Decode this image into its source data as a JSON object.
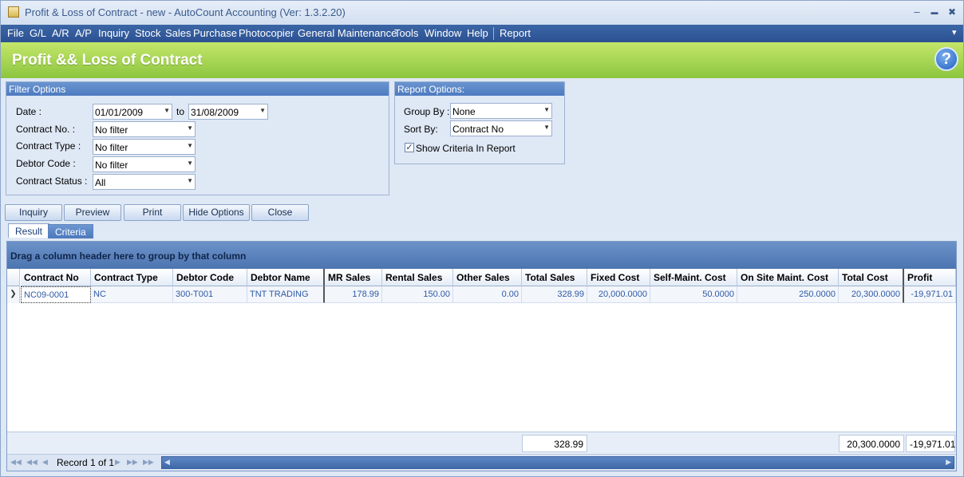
{
  "window": {
    "title": "Profit & Loss of Contract - new - AutoCount Accounting (Ver: 1.3.2.20)",
    "controls": [
      "–",
      "▬",
      "✖"
    ]
  },
  "menu": {
    "items": [
      "File",
      "G/L",
      "A/R",
      "A/P",
      "Inquiry",
      "Stock",
      "Sales",
      "Purchase",
      "Photocopier",
      "General Maintenance",
      "Tools",
      "Window",
      "Help",
      "Report"
    ],
    "overflow_glyph": "▾"
  },
  "banner": {
    "title": "Profit && Loss of Contract",
    "help_glyph": "?"
  },
  "filter_options": {
    "caption": "Filter Options",
    "date_label": "Date :",
    "date_from": "01/01/2009",
    "to_label": "to",
    "date_to": "31/08/2009",
    "contract_no_label": "Contract No. :",
    "contract_no_value": "No filter",
    "contract_type_label": "Contract Type :",
    "contract_type_value": "No filter",
    "debtor_code_label": "Debtor Code :",
    "debtor_code_value": "No filter",
    "contract_status_label": "Contract Status :",
    "contract_status_value": "All"
  },
  "report_options": {
    "caption": "Report Options:",
    "group_by_label": "Group By :",
    "group_by_value": "None",
    "sort_by_label": "Sort By:",
    "sort_by_value": "Contract No",
    "show_criteria_label": "Show Criteria In Report",
    "show_criteria_checked": true
  },
  "buttons": {
    "inquiry": "Inquiry",
    "preview": "Preview",
    "print": "Print",
    "hide_options": "Hide Options",
    "close": "Close"
  },
  "tabs": {
    "result": "Result",
    "criteria": "Criteria",
    "active": "result"
  },
  "grid": {
    "group_hint": "Drag a column header here to group by that column",
    "columns": [
      "Contract No",
      "Contract Type",
      "Debtor Code",
      "Debtor Name",
      "MR Sales",
      "Rental Sales",
      "Other Sales",
      "Total Sales",
      "Fixed Cost",
      "Self-Maint. Cost",
      "On Site Maint. Cost",
      "Total Cost",
      "Profit"
    ],
    "rows": [
      {
        "contract_no": "NC09-0001",
        "contract_type": "NC",
        "debtor_code": "300-T001",
        "debtor_name": "TNT TRADING",
        "mr_sales": "178.99",
        "rental_sales": "150.00",
        "other_sales": "0.00",
        "total_sales": "328.99",
        "fixed_cost": "20,000.0000",
        "self_maint_cost": "50.0000",
        "on_site_maint_cost": "250.0000",
        "total_cost": "20,300.0000",
        "profit": "-19,971.01"
      }
    ],
    "totals": {
      "total_sales": "328.99",
      "total_cost": "20,300.0000",
      "profit": "-19,971.01"
    },
    "record_text": "Record 1 of 1"
  },
  "colors": {
    "menu_bg": "#2c5192",
    "banner_green": "#8cc63f",
    "panel_caption": "#4d7bc0",
    "cell_text": "#2e5aa6"
  }
}
